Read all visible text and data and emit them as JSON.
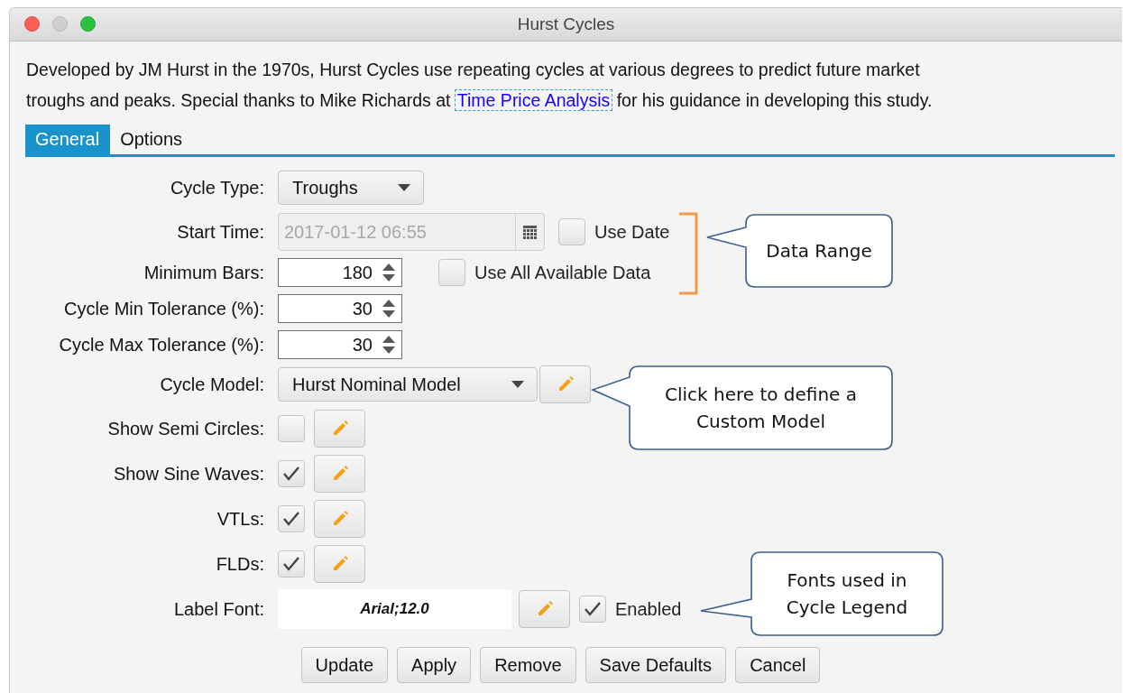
{
  "window": {
    "title": "Hurst Cycles"
  },
  "description": {
    "text_before": "Developed by JM Hurst in the 1970s, Hurst Cycles use repeating cycles at various degrees to predict future market troughs and peaks.  Special thanks to Mike Richards at ",
    "link": "Time Price Analysis",
    "text_after": " for his guidance in developing this study."
  },
  "tabs": [
    {
      "label": "General",
      "selected": true
    },
    {
      "label": "Options",
      "selected": false
    }
  ],
  "rows": [
    {
      "kind": "dropdown",
      "label": "Cycle Type:",
      "value": "Troughs",
      "edit_button": false
    },
    {
      "kind": "date",
      "label": "Start Time:",
      "value": "2017-01-12 06:55",
      "disabled": true,
      "option": {
        "label": "Use Date",
        "checked": false
      }
    },
    {
      "kind": "spinner",
      "label": "Minimum Bars:",
      "value": "180",
      "option": {
        "label": "Use All Available Data",
        "checked": false
      }
    },
    {
      "kind": "spinner",
      "label": "Cycle Min Tolerance (%):",
      "value": "30"
    },
    {
      "kind": "spinner",
      "label": "Cycle Max Tolerance (%):",
      "value": "30"
    },
    {
      "kind": "dropdown",
      "label": "Cycle Model:",
      "value": "Hurst Nominal Model",
      "edit_button": true
    },
    {
      "kind": "checkbox",
      "label": "Show Semi Circles:",
      "checked": false,
      "edit_button": true
    },
    {
      "kind": "checkbox",
      "label": "Show Sine Waves:",
      "checked": true,
      "edit_button": true
    },
    {
      "kind": "checkbox",
      "label": "VTLs:",
      "checked": true,
      "edit_button": true
    },
    {
      "kind": "checkbox",
      "label": "FLDs:",
      "checked": true,
      "edit_button": true
    },
    {
      "kind": "font",
      "label": "Label Font:",
      "value": "Arial;12.0",
      "edit_button": true,
      "option": {
        "label": "Enabled",
        "checked": true
      }
    }
  ],
  "buttons": [
    "Update",
    "Apply",
    "Remove",
    "Save Defaults",
    "Cancel"
  ],
  "callouts": [
    {
      "text": "Data Range"
    },
    {
      "text": "Click here to define a Custom Model"
    },
    {
      "text": "Fonts used in Cycle Legend"
    }
  ]
}
